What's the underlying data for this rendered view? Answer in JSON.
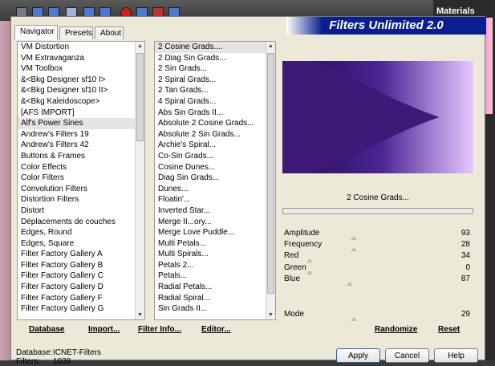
{
  "materials": {
    "title": "Materials"
  },
  "dialog": {
    "banner_title": "Filters Unlimited 2.0",
    "tabs": [
      {
        "label": "Navigator"
      },
      {
        "label": "Presets"
      },
      {
        "label": "About"
      }
    ],
    "categories": [
      "VM Distortion",
      "VM Extravaganza",
      "VM Toolbox",
      "&<Bkg Designer sf10 I>",
      "&<Bkg Designer sf10 II>",
      "&<Bkg Kaleidoscope>",
      "[AFS IMPORT]",
      "Alf's Power Sines",
      "Andrew's Filters 19",
      "Andrew's Filters 42",
      "Buttons & Frames",
      "Color Effects",
      "Color Filters",
      "Convolution Filters",
      "Distortion Filters",
      "Distort",
      "Déplacements de couches",
      "Edges, Round",
      "Edges, Square",
      "Filter Factory Gallery A",
      "Filter Factory Gallery B",
      "Filter Factory Gallery C",
      "Filter Factory Gallery D",
      "Filter Factory Gallery F",
      "Filter Factory Gallery G"
    ],
    "filters": [
      "2 Cosine Grads....",
      "2 Diag Sin Grads...",
      "2 Sin Grads...",
      "2 Spiral Grads...",
      "2 Tan Grads...",
      "4 Spiral Grads...",
      "Abs Sin Grads II...",
      "Absolute 2 Cosine Grads...",
      "Absolute 2 Sin Grads...",
      "Archie's Spiral...",
      "Co-Sin Grads...",
      "Cosine Dunes...",
      "Diag Sin Grads...",
      "Dunes...",
      "Floatin'...",
      "Inverted Star...",
      "Merge II...ory...",
      "Merge Love Puddle...",
      "Multi Petals...",
      "Multi Spirals...",
      "Petals 2...",
      "Petals...",
      "Radial Petals...",
      "Radial Spiral...",
      "Sin Grads II..."
    ],
    "filter_name": "2 Cosine Grads...",
    "params": [
      {
        "label": "Amplitude",
        "value": "93"
      },
      {
        "label": "Frequency",
        "value": "28"
      },
      {
        "label": "Red",
        "value": "34"
      },
      {
        "label": "Green",
        "value": "0"
      },
      {
        "label": "Blue",
        "value": "87"
      },
      {
        "label": "Mode",
        "value": "29"
      }
    ],
    "links": {
      "database": "Database",
      "import": "Import...",
      "filter_info": "Filter Info...",
      "editor": "Editor...",
      "randomize": "Randomize",
      "reset": "Reset"
    },
    "info": {
      "database_label": "Database:",
      "database_value": "ICNET-Filters",
      "filters_label": "Filters:",
      "filters_value": "1038"
    },
    "buttons": {
      "apply": "Apply",
      "cancel": "Cancel",
      "help": "Help"
    },
    "colors": {
      "preview_dark": "#3d1a78",
      "preview_light": "#e8c8ff",
      "banner": "#0a1f8f"
    }
  }
}
